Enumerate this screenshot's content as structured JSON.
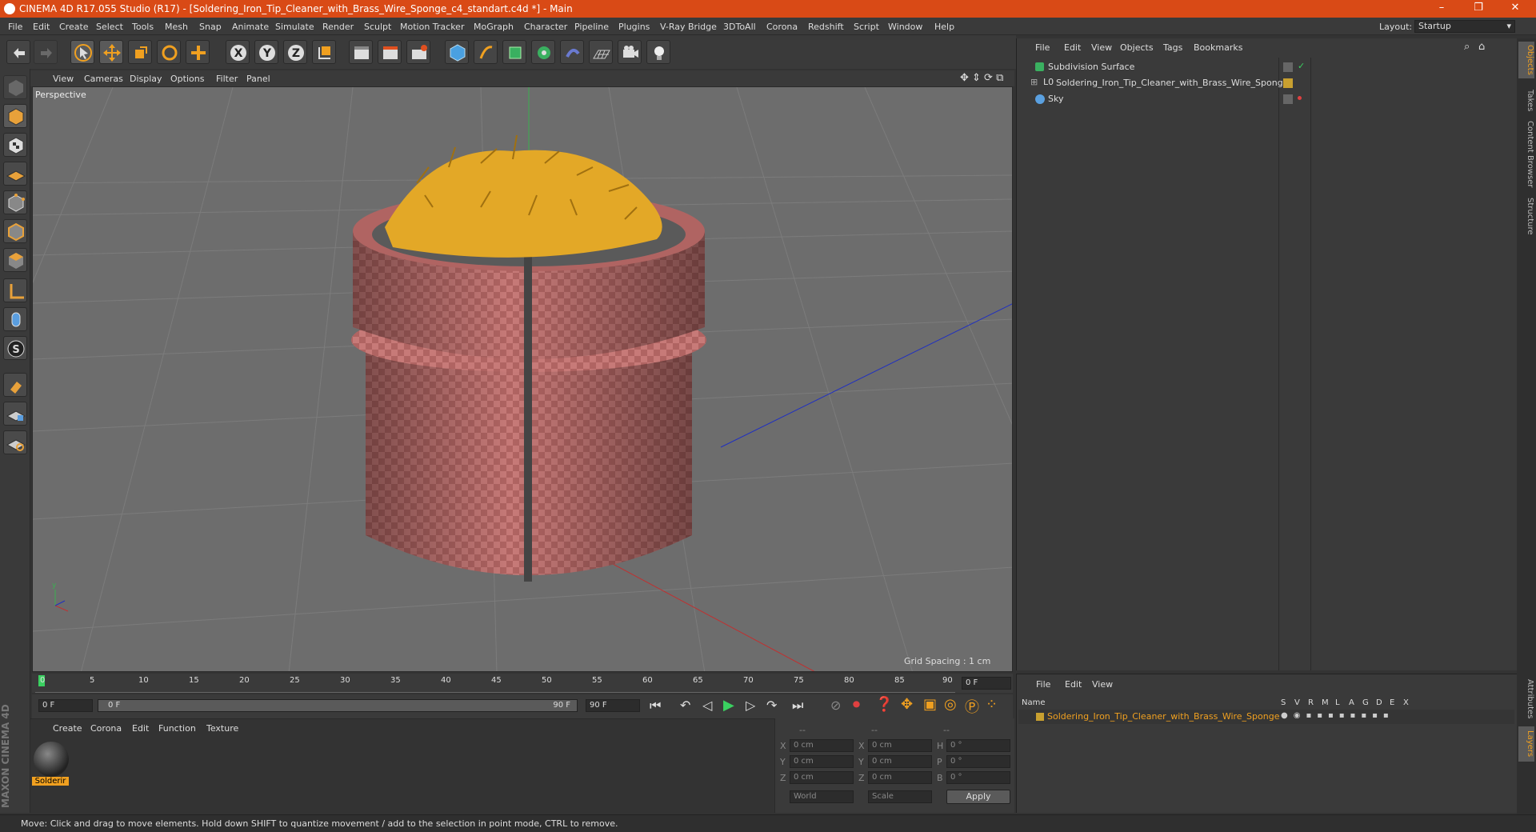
{
  "window": {
    "title": "CINEMA 4D R17.055 Studio (R17) - [Soldering_Iron_Tip_Cleaner_with_Brass_Wire_Sponge_c4_standart.c4d *] - Main"
  },
  "menu": [
    "File",
    "Edit",
    "Create",
    "Select",
    "Tools",
    "Mesh",
    "Snap",
    "Animate",
    "Simulate",
    "Render",
    "Sculpt",
    "Motion Tracker",
    "MoGraph",
    "Character",
    "Pipeline",
    "Plugins",
    "V-Ray Bridge",
    "3DToAll",
    "Corona",
    "Redshift",
    "Script",
    "Window",
    "Help"
  ],
  "layout": {
    "label": "Layout:",
    "value": "Startup"
  },
  "viewport": {
    "menu": [
      "View",
      "Cameras",
      "Display",
      "Options",
      "Filter",
      "Panel"
    ],
    "label": "Perspective",
    "grid_spacing": "Grid Spacing : 1 cm"
  },
  "timeline": {
    "ticks": [
      "0",
      "5",
      "10",
      "15",
      "20",
      "25",
      "30",
      "35",
      "40",
      "45",
      "50",
      "55",
      "60",
      "65",
      "70",
      "75",
      "80",
      "85",
      "90"
    ],
    "current_frame": "0 F",
    "start_field": "0 F",
    "range_start": "0 F",
    "range_end": "90 F",
    "end_field": "90 F"
  },
  "material_panel": {
    "menu": [
      "Create",
      "Corona",
      "Edit",
      "Function",
      "Texture"
    ],
    "material_name": "Solderir"
  },
  "coords": {
    "headers": [
      "--",
      "--",
      "--"
    ],
    "rows": [
      {
        "a": "X",
        "av": "0 cm",
        "b": "X",
        "bv": "0 cm",
        "c": "H",
        "cv": "0 °"
      },
      {
        "a": "Y",
        "av": "0 cm",
        "b": "Y",
        "bv": "0 cm",
        "c": "P",
        "cv": "0 °"
      },
      {
        "a": "Z",
        "av": "0 cm",
        "b": "Z",
        "bv": "0 cm",
        "c": "B",
        "cv": "0 °"
      }
    ],
    "world": "World",
    "scale": "Scale",
    "apply": "Apply"
  },
  "object_manager": {
    "menu": [
      "File",
      "Edit",
      "View",
      "Objects",
      "Tags",
      "Bookmarks"
    ],
    "objects": [
      {
        "name": "Subdivision Surface"
      },
      {
        "name": "Soldering_Iron_Tip_Cleaner_with_Brass_Wire_Sponge"
      },
      {
        "name": "Sky"
      }
    ]
  },
  "layer_manager": {
    "menu": [
      "File",
      "Edit",
      "View"
    ],
    "name_header": "Name",
    "flags": [
      "S",
      "V",
      "R",
      "M",
      "L",
      "A",
      "G",
      "D",
      "E",
      "X"
    ],
    "layer_name": "Soldering_Iron_Tip_Cleaner_with_Brass_Wire_Sponge"
  },
  "right_tabs": [
    "Objects",
    "Takes",
    "Content Browser",
    "Structure",
    "Attributes",
    "Layers"
  ],
  "status": "Move: Click and drag to move elements. Hold down SHIFT to quantize movement / add to the selection in point mode, CTRL to remove.",
  "brand": "MAXON CINEMA 4D",
  "colors": {
    "title_bar": "#d94a16",
    "accent": "#f0a020",
    "highlight": "#e8a13a"
  }
}
